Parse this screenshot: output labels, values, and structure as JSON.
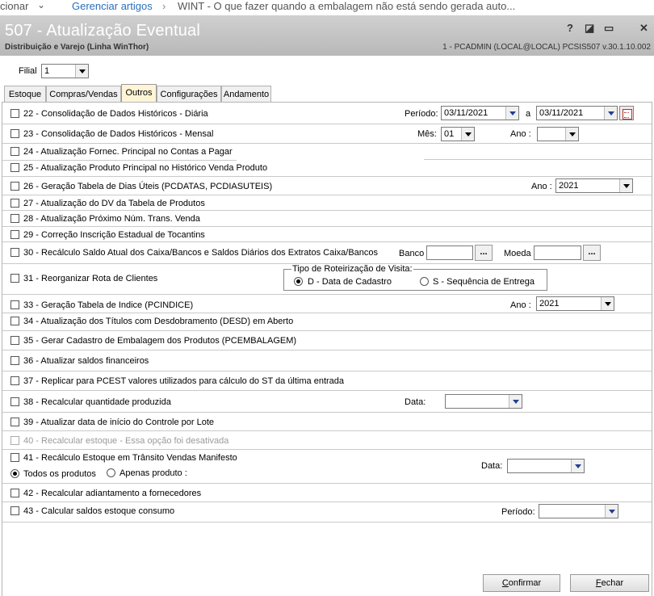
{
  "breadcrumb": {
    "prefix": "cionar",
    "link": "Gerenciar artigos",
    "current": "WINT - O que fazer quando a embalagem não está sendo gerada auto..."
  },
  "window": {
    "title": "507 - Atualização Eventual",
    "subtitle": "Distribuição e Varejo (Linha WinThor)",
    "user_info": "1 - PCADMIN (LOCAL@LOCAL)   PCSIS507  v.30.1.10.002",
    "controls": [
      "?",
      "◪",
      "▭",
      "✕"
    ]
  },
  "filial": {
    "label": "Filial",
    "value": "1"
  },
  "tabs": [
    "Estoque",
    "Compras/Vendas",
    "Outros",
    "Configurações",
    "Andamento"
  ],
  "active_tab": "Outros",
  "options": {
    "o22": "22 - Consolidação de Dados Históricos - Diária",
    "o23": "23 - Consolidação de Dados Históricos - Mensal",
    "o24": "24 - Atualização Fornec. Principal no Contas a Pagar",
    "o25": "25 - Atualização Produto Principal no Histórico Venda Produto",
    "o26": "26 - Geração Tabela de Dias Úteis (PCDATAS, PCDIASUTEIS)",
    "o27": "27 - Atualização do DV da Tabela de Produtos",
    "o28": "28 - Atualização Próximo Núm. Trans. Venda",
    "o29": "29 - Correção Inscrição Estadual de Tocantins",
    "o30": "30 - Recálculo Saldo Atual dos Caixa/Bancos e Saldos Diários dos Extratos Caixa/Bancos",
    "o31": "31 - Reorganizar Rota de Clientes",
    "o33": "33 - Geração Tabela de Indice (PCINDICE)",
    "o34": "34 - Atualização dos Títulos com Desdobramento (DESD) em Aberto",
    "o35": "35 - Gerar Cadastro de Embalagem dos Produtos (PCEMBALAGEM)",
    "o36": "36 - Atualizar saldos financeiros",
    "o37": "37 - Replicar para PCEST valores utilizados para cálculo do ST da última entrada",
    "o38": "38 - Recalcular quantidade produzida",
    "o39": "39 - Atualizar data de início do Controle por Lote",
    "o40": "40 - Recalcular estoque - Essa opção foi desativada",
    "o41": "41 - Recálculo Estoque em Trânsito Vendas Manifesto",
    "o42": "42 - Recalcular adiantamento a fornecedores",
    "o43": "43 - Calcular saldos estoque consumo"
  },
  "fields": {
    "periodo_label": "Período:",
    "periodo_start": "03/11/2021",
    "periodo_sep": "a",
    "periodo_end": "03/11/2021",
    "mes_label": "Mês:",
    "mes_value": "01",
    "ano23_label": "Ano :",
    "ano23_value": "",
    "ano26_label": "Ano :",
    "ano26_value": "2021",
    "banco_label": "Banco",
    "moeda_label": "Moeda",
    "ellipsis": "...",
    "roteirizacao_label": "Tipo de Roteirização de Visita:",
    "roteirizacao_d": "D - Data de Cadastro",
    "roteirizacao_s": "S - Sequência de Entrega",
    "ano33_label": "Ano :",
    "ano33_value": "2021",
    "data38_label": "Data:",
    "data41_label": "Data:",
    "todos_produtos": "Todos os produtos",
    "apenas_produto": "Apenas produto :",
    "periodo43_label": "Período:"
  },
  "buttons": {
    "confirmar_first": "C",
    "confirmar_rest": "onfirmar",
    "fechar_first": "F",
    "fechar_rest": "echar"
  }
}
